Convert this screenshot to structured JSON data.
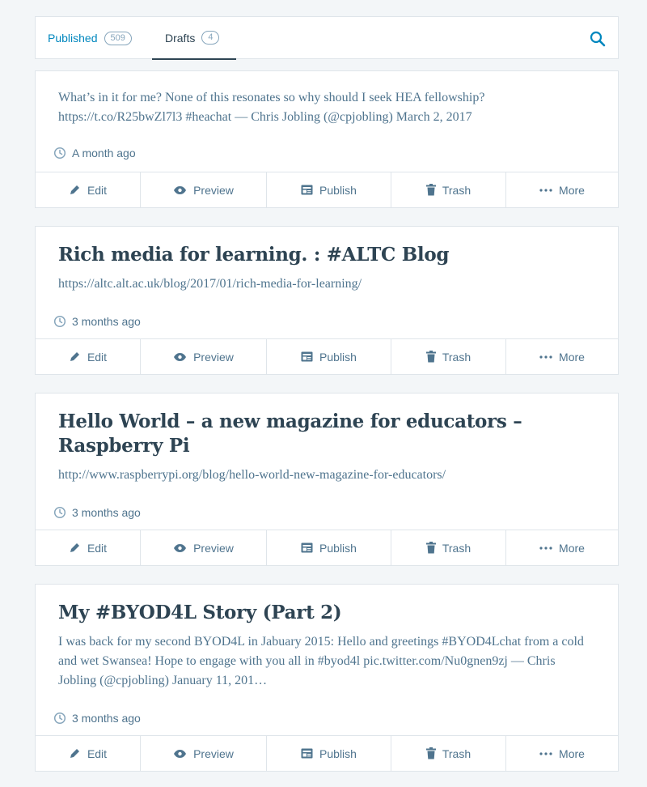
{
  "tabs": {
    "published_label": "Published",
    "published_count": "509",
    "drafts_label": "Drafts",
    "drafts_count": "4"
  },
  "icons": {
    "search": "search-icon",
    "clock": "clock-icon",
    "edit": "pencil-icon",
    "preview": "eye-icon",
    "publish": "publish-icon",
    "trash": "trash-icon",
    "more": "ellipsis-icon"
  },
  "colors": {
    "accent": "#0087be",
    "text": "#2e4453",
    "muted": "#4f748e",
    "border": "#dfe5ea"
  },
  "actions": {
    "edit": "Edit",
    "preview": "Preview",
    "publish": "Publish",
    "trash": "Trash",
    "more": "More"
  },
  "posts": [
    {
      "title": "",
      "excerpt": "What’s in it for me? None of this resonates so why should I seek HEA fellowship? https://t.co/R25bwZl7l3 #heachat — Chris Jobling (@cpjobling) March 2, 2017",
      "time": "A month ago"
    },
    {
      "title": "Rich media for learning. : #ALTC Blog",
      "excerpt": "https://altc.alt.ac.uk/blog/2017/01/rich-media-for-learning/",
      "time": "3 months ago"
    },
    {
      "title": "Hello World – a new magazine for educators – Raspberry Pi",
      "excerpt": "http://www.raspberrypi.org/blog/hello-world-new-magazine-for-educators/",
      "time": "3 months ago"
    },
    {
      "title": "My #BYOD4L Story (Part 2)",
      "excerpt": "I was back for my second BYOD4L in Jabuary 2015: Hello and greetings #BYOD4Lchat from a cold and wet Swansea! Hope to engage with you all in #byod4l pic.twitter.com/Nu0gnen9zj — Chris Jobling (@cpjobling) January 11, 201…",
      "time": "3 months ago"
    }
  ]
}
